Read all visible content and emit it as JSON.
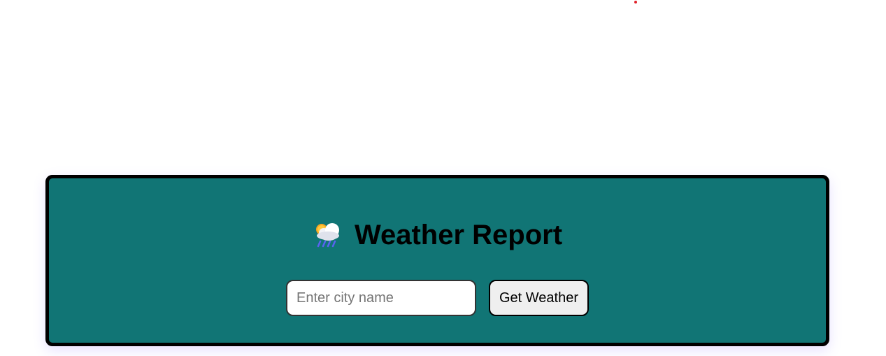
{
  "app": {
    "title": "Weather Report",
    "title_icon": "sun-behind-rain-cloud-icon"
  },
  "search": {
    "placeholder": "Enter city name",
    "value": ""
  },
  "actions": {
    "get_weather_label": "Get Weather"
  },
  "colors": {
    "card_background": "#117575",
    "card_border": "#000000",
    "button_background": "#efefef",
    "indicator_dot": "#e0202a"
  }
}
